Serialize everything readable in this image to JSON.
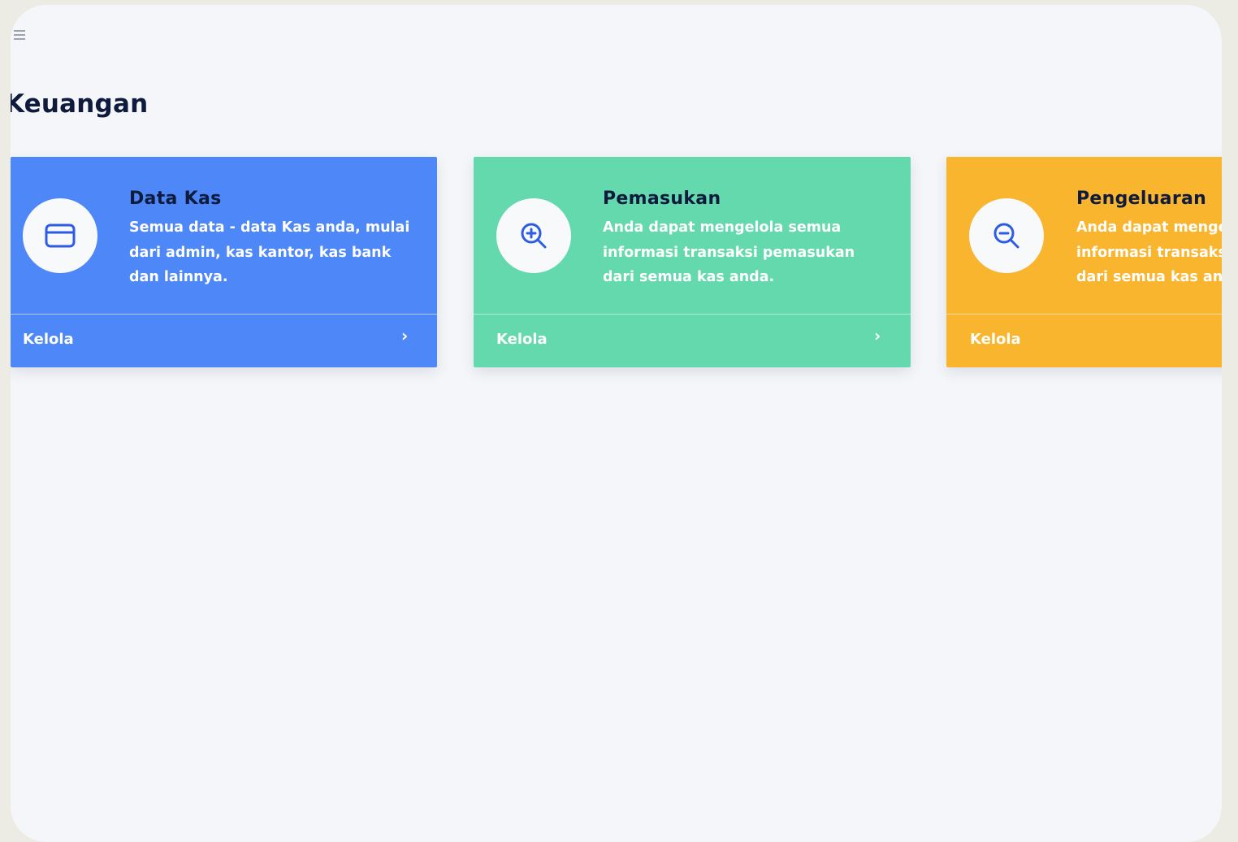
{
  "header": {
    "menu_icon": "hamburger-icon",
    "title": "Keuangan"
  },
  "cards": [
    {
      "title": "Data Kas",
      "description": "Semua data - data Kas anda, mulai dari admin, kas kantor, kas bank dan lainnya.",
      "icon": "credit-card-icon",
      "footer_label": "Kelola",
      "color": "#4e88f8"
    },
    {
      "title": "Pemasukan",
      "description": "Anda dapat mengelola semua informasi transaksi pemasukan dari semua kas anda.",
      "icon": "zoom-in-icon",
      "footer_label": "Kelola",
      "color": "#63d9ad"
    },
    {
      "title": "Pengeluaran",
      "description": "Anda dapat mengelola semua informasi transaksi pengeluaran dari semua kas anda.",
      "icon": "zoom-out-icon",
      "footer_label": "Kelola",
      "color": "#f9b52e"
    }
  ],
  "colors": {
    "icon_accent": "#2d5be3",
    "title_text": "#0f1b3d",
    "background": "#f4f6f9"
  }
}
